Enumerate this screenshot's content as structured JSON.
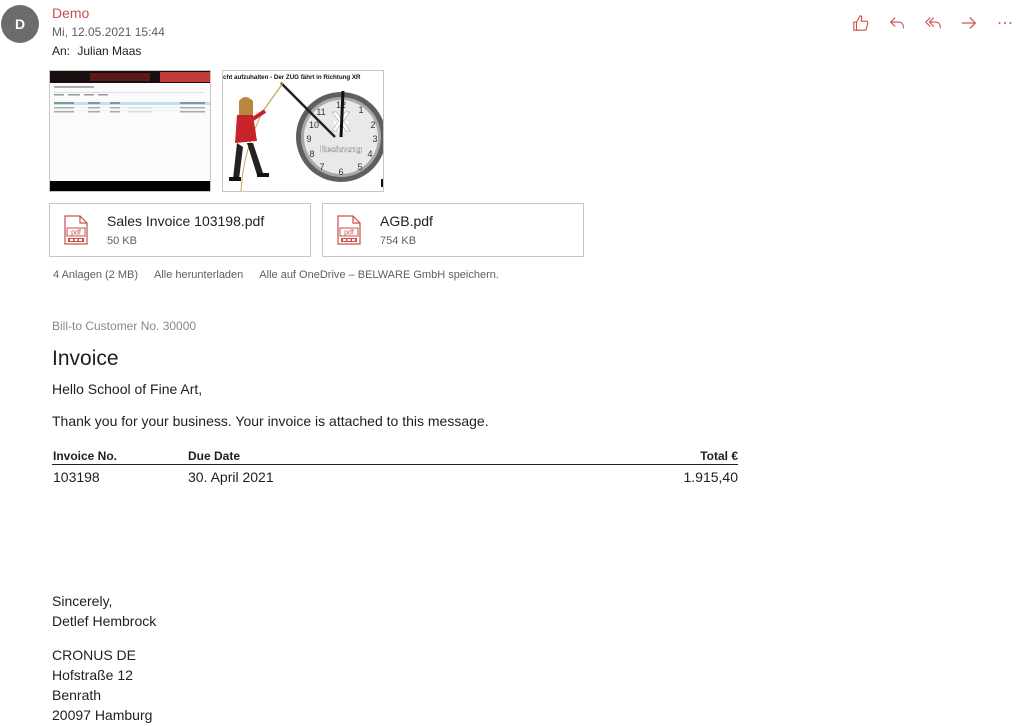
{
  "header": {
    "avatar_initial": "D",
    "sender": "Demo",
    "date": "Mi, 12.05.2021 15:44",
    "to_label": "An:",
    "to_name": "Julian Maas"
  },
  "actions": [
    {
      "name": "like-button",
      "icon": "thumbs-up-icon"
    },
    {
      "name": "reply-button",
      "icon": "reply-icon"
    },
    {
      "name": "reply-all-button",
      "icon": "reply-all-icon"
    },
    {
      "name": "forward-button",
      "icon": "forward-icon"
    },
    {
      "name": "more-actions-button",
      "icon": "more-icon"
    }
  ],
  "accent_color": "#c8504a",
  "thumbnails": [
    {
      "kind": "screenshot-thumbnail"
    },
    {
      "kind": "clock-image-thumbnail",
      "caption": "cht aufzuhalten - Der ZUG fährt in Richtung XR",
      "clock_label": "Rechnung"
    }
  ],
  "files": [
    {
      "name": "Sales Invoice 103198.pdf",
      "size": "50 KB",
      "icon": "pdf-icon",
      "icon_label": "pdf"
    },
    {
      "name": "AGB.pdf",
      "size": "754 KB",
      "icon": "pdf-icon",
      "icon_label": "pdf"
    }
  ],
  "attachments_bar": {
    "count": "4 Anlagen (2 MB)",
    "download_all": "Alle herunterladen",
    "save_onedrive": "Alle auf OneDrive – BELWARE GmbH speichern."
  },
  "mail_body": {
    "bill_to": "Bill-to Customer No. 30000",
    "title": "Invoice",
    "greeting": "Hello School of Fine Art,",
    "thanks": "Thank you for your business. Your invoice is attached to this message.",
    "table": {
      "headers": [
        "Invoice No.",
        "Due Date",
        "Total €"
      ],
      "rows": [
        [
          "103198",
          "30. April 2021",
          "1.915,40"
        ]
      ]
    },
    "closing": "Sincerely,",
    "signature": "Detlef Hembrock",
    "company": [
      "CRONUS DE",
      "Hofstraße 12",
      "Benrath",
      "20097 Hamburg"
    ]
  }
}
